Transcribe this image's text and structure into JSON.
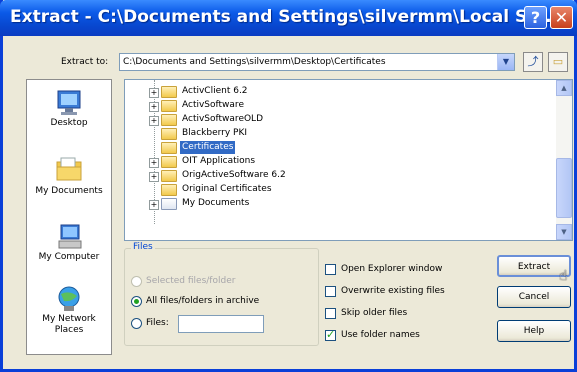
{
  "window": {
    "title": "Extract - C:\\Documents and Settings\\silvermm\\Local Se...",
    "help_button": "?",
    "close_button": "✕"
  },
  "extract_to": {
    "label": "Extract to:",
    "value": "C:\\Documents and Settings\\silvermm\\Desktop\\Certificates"
  },
  "places": [
    {
      "label": "Desktop",
      "icon": "desktop-icon"
    },
    {
      "label": "My Documents",
      "icon": "my-documents-icon"
    },
    {
      "label": "My Computer",
      "icon": "my-computer-icon"
    },
    {
      "label": "My Network Places",
      "icon": "network-places-icon"
    }
  ],
  "tree": {
    "items": [
      {
        "label": "ActivClient 6.2",
        "expandable": true
      },
      {
        "label": "ActivSoftware",
        "expandable": true
      },
      {
        "label": "ActivSoftwareOLD",
        "expandable": true
      },
      {
        "label": "Blackberry PKI",
        "expandable": false
      },
      {
        "label": "Certificates",
        "expandable": false,
        "selected": true
      },
      {
        "label": "OIT Applications",
        "expandable": true
      },
      {
        "label": "OrigActiveSoftware 6.2",
        "expandable": true
      },
      {
        "label": "Original Certificates",
        "expandable": false
      },
      {
        "label": "My Documents",
        "expandable": true
      }
    ]
  },
  "files_group": {
    "title": "Files",
    "selected_files": "Selected files/folder",
    "all_files": "All files/folders in archive",
    "files": "Files:",
    "files_value": ""
  },
  "options": {
    "open_explorer": {
      "label": "Open Explorer window",
      "checked": false
    },
    "overwrite": {
      "label": "Overwrite existing files",
      "checked": false
    },
    "skip_older": {
      "label": "Skip older files",
      "checked": false
    },
    "use_folder_names": {
      "label": "Use folder names",
      "checked": true
    }
  },
  "buttons": {
    "extract": "Extract",
    "cancel": "Cancel",
    "help": "Help"
  },
  "colors": {
    "titlebar": "#0b5ae8",
    "selection": "#316ac5",
    "group_title": "#0046d5"
  }
}
